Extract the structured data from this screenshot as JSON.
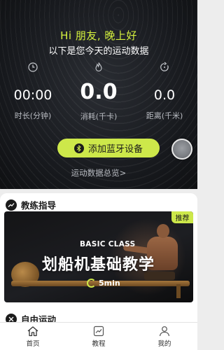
{
  "header": {
    "greeting": "Hi 朋友, 晚上好",
    "subtitle": "以下是您今天的运动数据"
  },
  "stats": [
    {
      "icon": "clock-icon",
      "value": "00:00",
      "label": "时长(分钟)"
    },
    {
      "icon": "flame-icon",
      "value": "0.0",
      "label": "消耗(千卡)"
    },
    {
      "icon": "distance-icon",
      "value": "0.0",
      "label": "距离(千米)"
    }
  ],
  "actions": {
    "bluetooth_label": "添加蓝牙设备",
    "overview_label": "运动数据总览>"
  },
  "coach_section": {
    "title": "教练指导",
    "banner": {
      "badge": "推荐",
      "title_en": "BASIC CLASS",
      "title_cn": "划船机基础教学",
      "duration": "5min"
    }
  },
  "free_section": {
    "title": "自由运动"
  },
  "tabbar": {
    "items": [
      {
        "label": "首页",
        "icon": "home-icon"
      },
      {
        "label": "教程",
        "icon": "chart-icon"
      },
      {
        "label": "我的",
        "icon": "user-icon"
      }
    ]
  },
  "colors": {
    "accent": "#cde84a",
    "hero_bg": "#16181c"
  }
}
